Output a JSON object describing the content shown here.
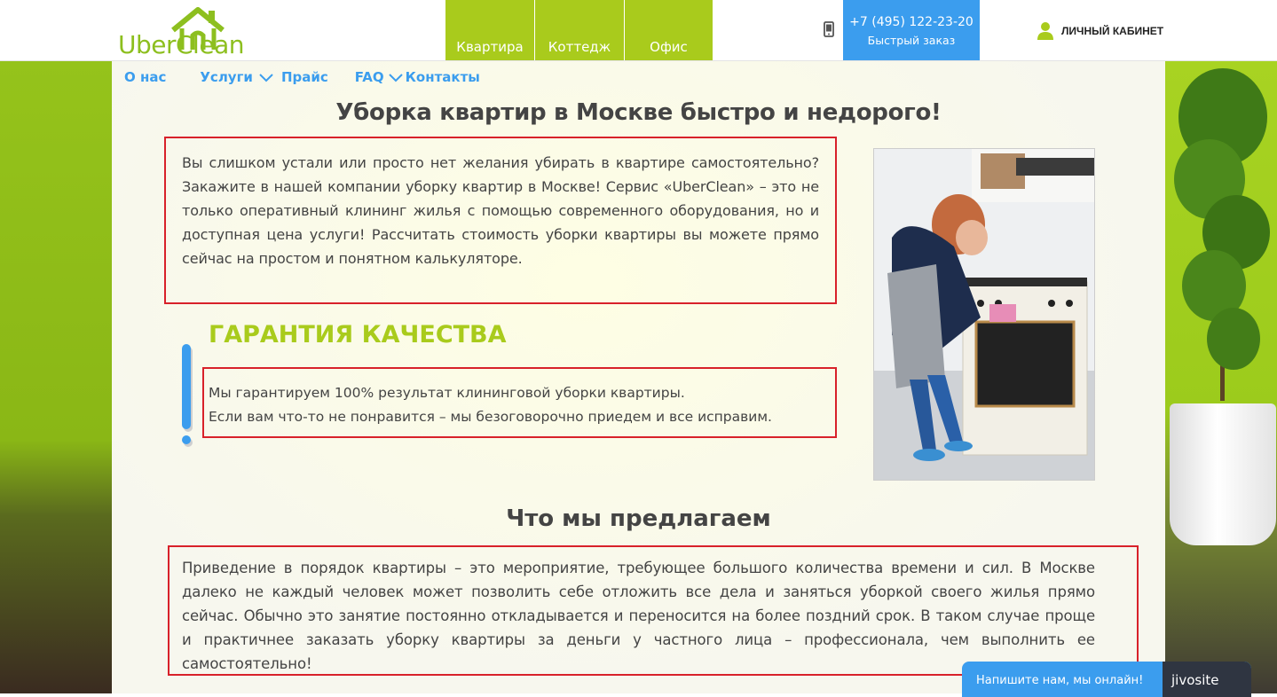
{
  "header": {
    "logo_text": "UberClean",
    "tabs": [
      "Квартира",
      "Коттедж",
      "Офис"
    ],
    "phone": "+7 (495) 122-23-20",
    "phone_sub": "Быстрый заказ",
    "cabinet": "ЛИЧНЫЙ КАБИНЕТ"
  },
  "nav": {
    "about": "О нас",
    "services": "Услуги",
    "price": "Прайс",
    "faq": "FAQ",
    "contacts": "Контакты"
  },
  "main": {
    "title": "Уборка квартир в Москве быстро и недорого!",
    "intro": "Вы слишком устали или просто нет желания убирать в квартире самостоятельно? Закажите в нашей компании уборку квартир в Москве! Сервис «UberClean» – это не только оперативный клининг жилья с помощью современного оборудования, но и доступная цена услуги! Рассчитать стоимость уборки квартиры вы можете прямо сейчас на простом и понятном калькуляторе.",
    "guarantee_title": "ГАРАНТИЯ КАЧЕСТВА",
    "guarantee_line1": "Мы гарантируем 100% результат клининговой уборки квартиры.",
    "guarantee_line2": "Если вам что-то не понравится – мы безоговорочно приедем и все исправим.",
    "offer_title": "Что мы предлагаем",
    "offer_text": "Приведение в порядок квартиры – это мероприятие, требующее большого количества времени и сил. В Москве далеко не каждый человек может позволить себе отложить все дела и заняться уборкой своего жилья прямо сейчас. Обычно это занятие постоянно откладывается и переносится на более поздний срок. В таком случае проще и практичнее заказать уборку квартиры за деньги у частного лица – профессионала, чем выполнить ее самостоятельно!"
  },
  "chat": {
    "text": "Напишите нам, мы онлайн!",
    "brand": "jivosite"
  },
  "colors": {
    "accent_green": "#a9cb1c",
    "accent_blue": "#3b9dee",
    "highlight_red": "#d8212a"
  }
}
